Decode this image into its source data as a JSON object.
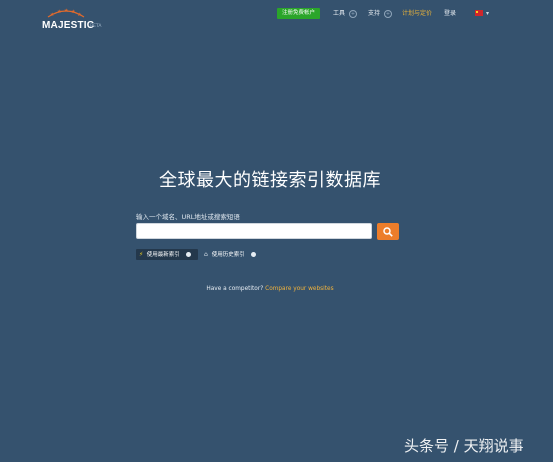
{
  "brand": {
    "name": "MAJESTIC",
    "badge": "BETA"
  },
  "header": {
    "signup_label": "注册免费帐户",
    "nav": [
      {
        "label": "工具",
        "has_plus": true
      },
      {
        "label": "支持",
        "has_plus": true
      },
      {
        "label": "计划与定价",
        "has_plus": false
      },
      {
        "label": "登录",
        "has_plus": false
      }
    ],
    "language": "中文"
  },
  "main": {
    "title": "全球最大的链接索引数据库",
    "search": {
      "prompt": "输入一个域名、URL地址或搜索短语",
      "value": "",
      "placeholder": ""
    },
    "index_options": {
      "fresh_label": "使用最新索引",
      "historic_label": "使用历史索引",
      "selected": "fresh"
    },
    "competitor": {
      "text": "Have a competitor?",
      "link": "Compare your websites"
    }
  },
  "watermark": "头条号 / 天翔说事",
  "colors": {
    "background": "#35526e",
    "signup": "#2aa52a",
    "search_button": "#ec7d2a",
    "link": "#f0b23c"
  }
}
